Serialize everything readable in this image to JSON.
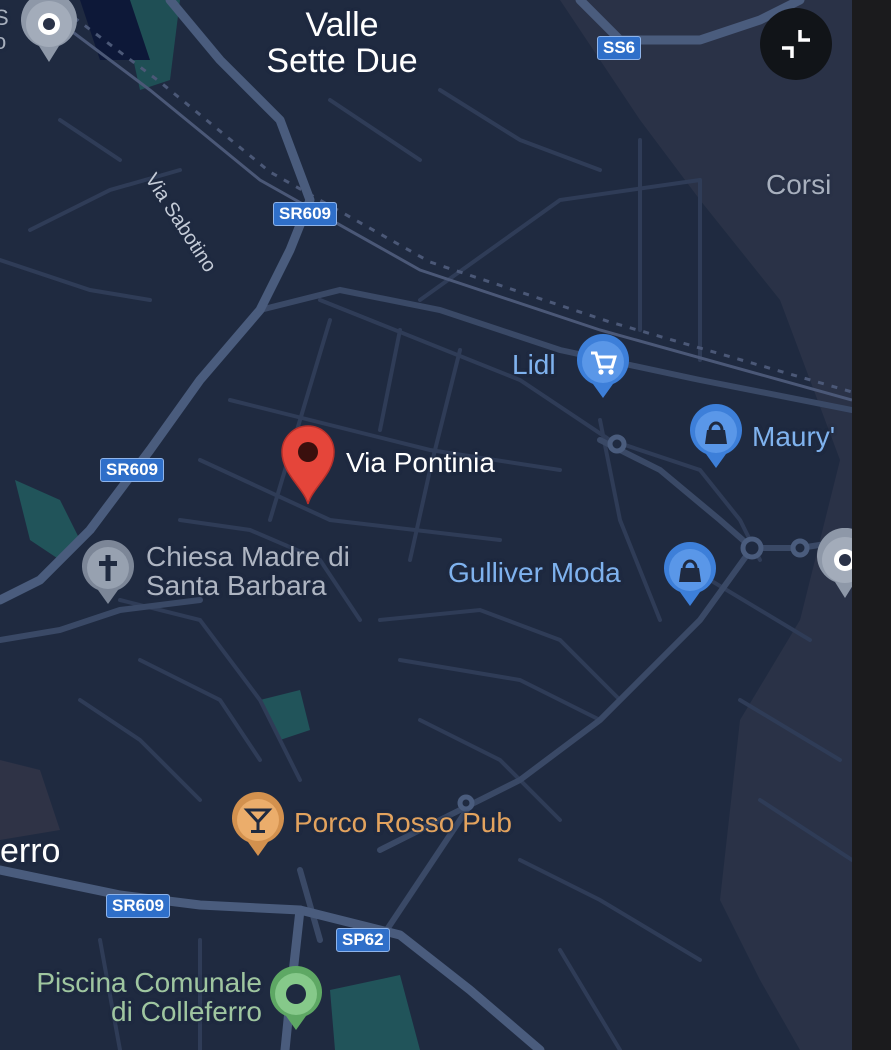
{
  "map": {
    "place_labels": {
      "valle_line1": "Valle",
      "valle_line2": "Sette Due",
      "corsi": "Corsi",
      "colleferro_partial": "erro",
      "top_left_partial": "S\no"
    },
    "street_labels": {
      "via_sabotino": "Via Sabotino"
    },
    "road_shields": {
      "ss6": "SS6",
      "sr609_top": "SR609",
      "sr609_mid": "SR609",
      "sr609_bottom": "SR609",
      "sp62": "SP62"
    },
    "pin": {
      "label": "Via Pontinia",
      "color": "#e5453a"
    },
    "pois": {
      "lidl": {
        "label": "Lidl",
        "icon": "shopping-cart-icon",
        "color": "#4a8fe7"
      },
      "maury": {
        "label": "Maury'",
        "icon": "shopping-bag-icon",
        "color": "#4a8fe7"
      },
      "gulliver": {
        "label": "Gulliver Moda",
        "icon": "shopping-bag-icon",
        "color": "#4a8fe7"
      },
      "chiesa": {
        "line1": "Chiesa Madre di",
        "line2": "Santa Barbara",
        "icon": "cross-icon",
        "color": "#8e98a8"
      },
      "porco_rosso": {
        "label": "Porco Rosso Pub",
        "icon": "cocktail-icon",
        "color": "#e8a25b"
      },
      "piscina": {
        "line1": "Piscina Comunale",
        "line2": "di Colleferro",
        "icon": "park-dot-icon",
        "color": "#6fbf74"
      }
    },
    "colors": {
      "background": "#1f2a40",
      "roads": "#34425e",
      "highways": "#4a5c7d",
      "water_park": "#21545a",
      "shield": "#2f6fc9"
    }
  },
  "controls": {
    "collapse_icon": "collapse-icon"
  }
}
